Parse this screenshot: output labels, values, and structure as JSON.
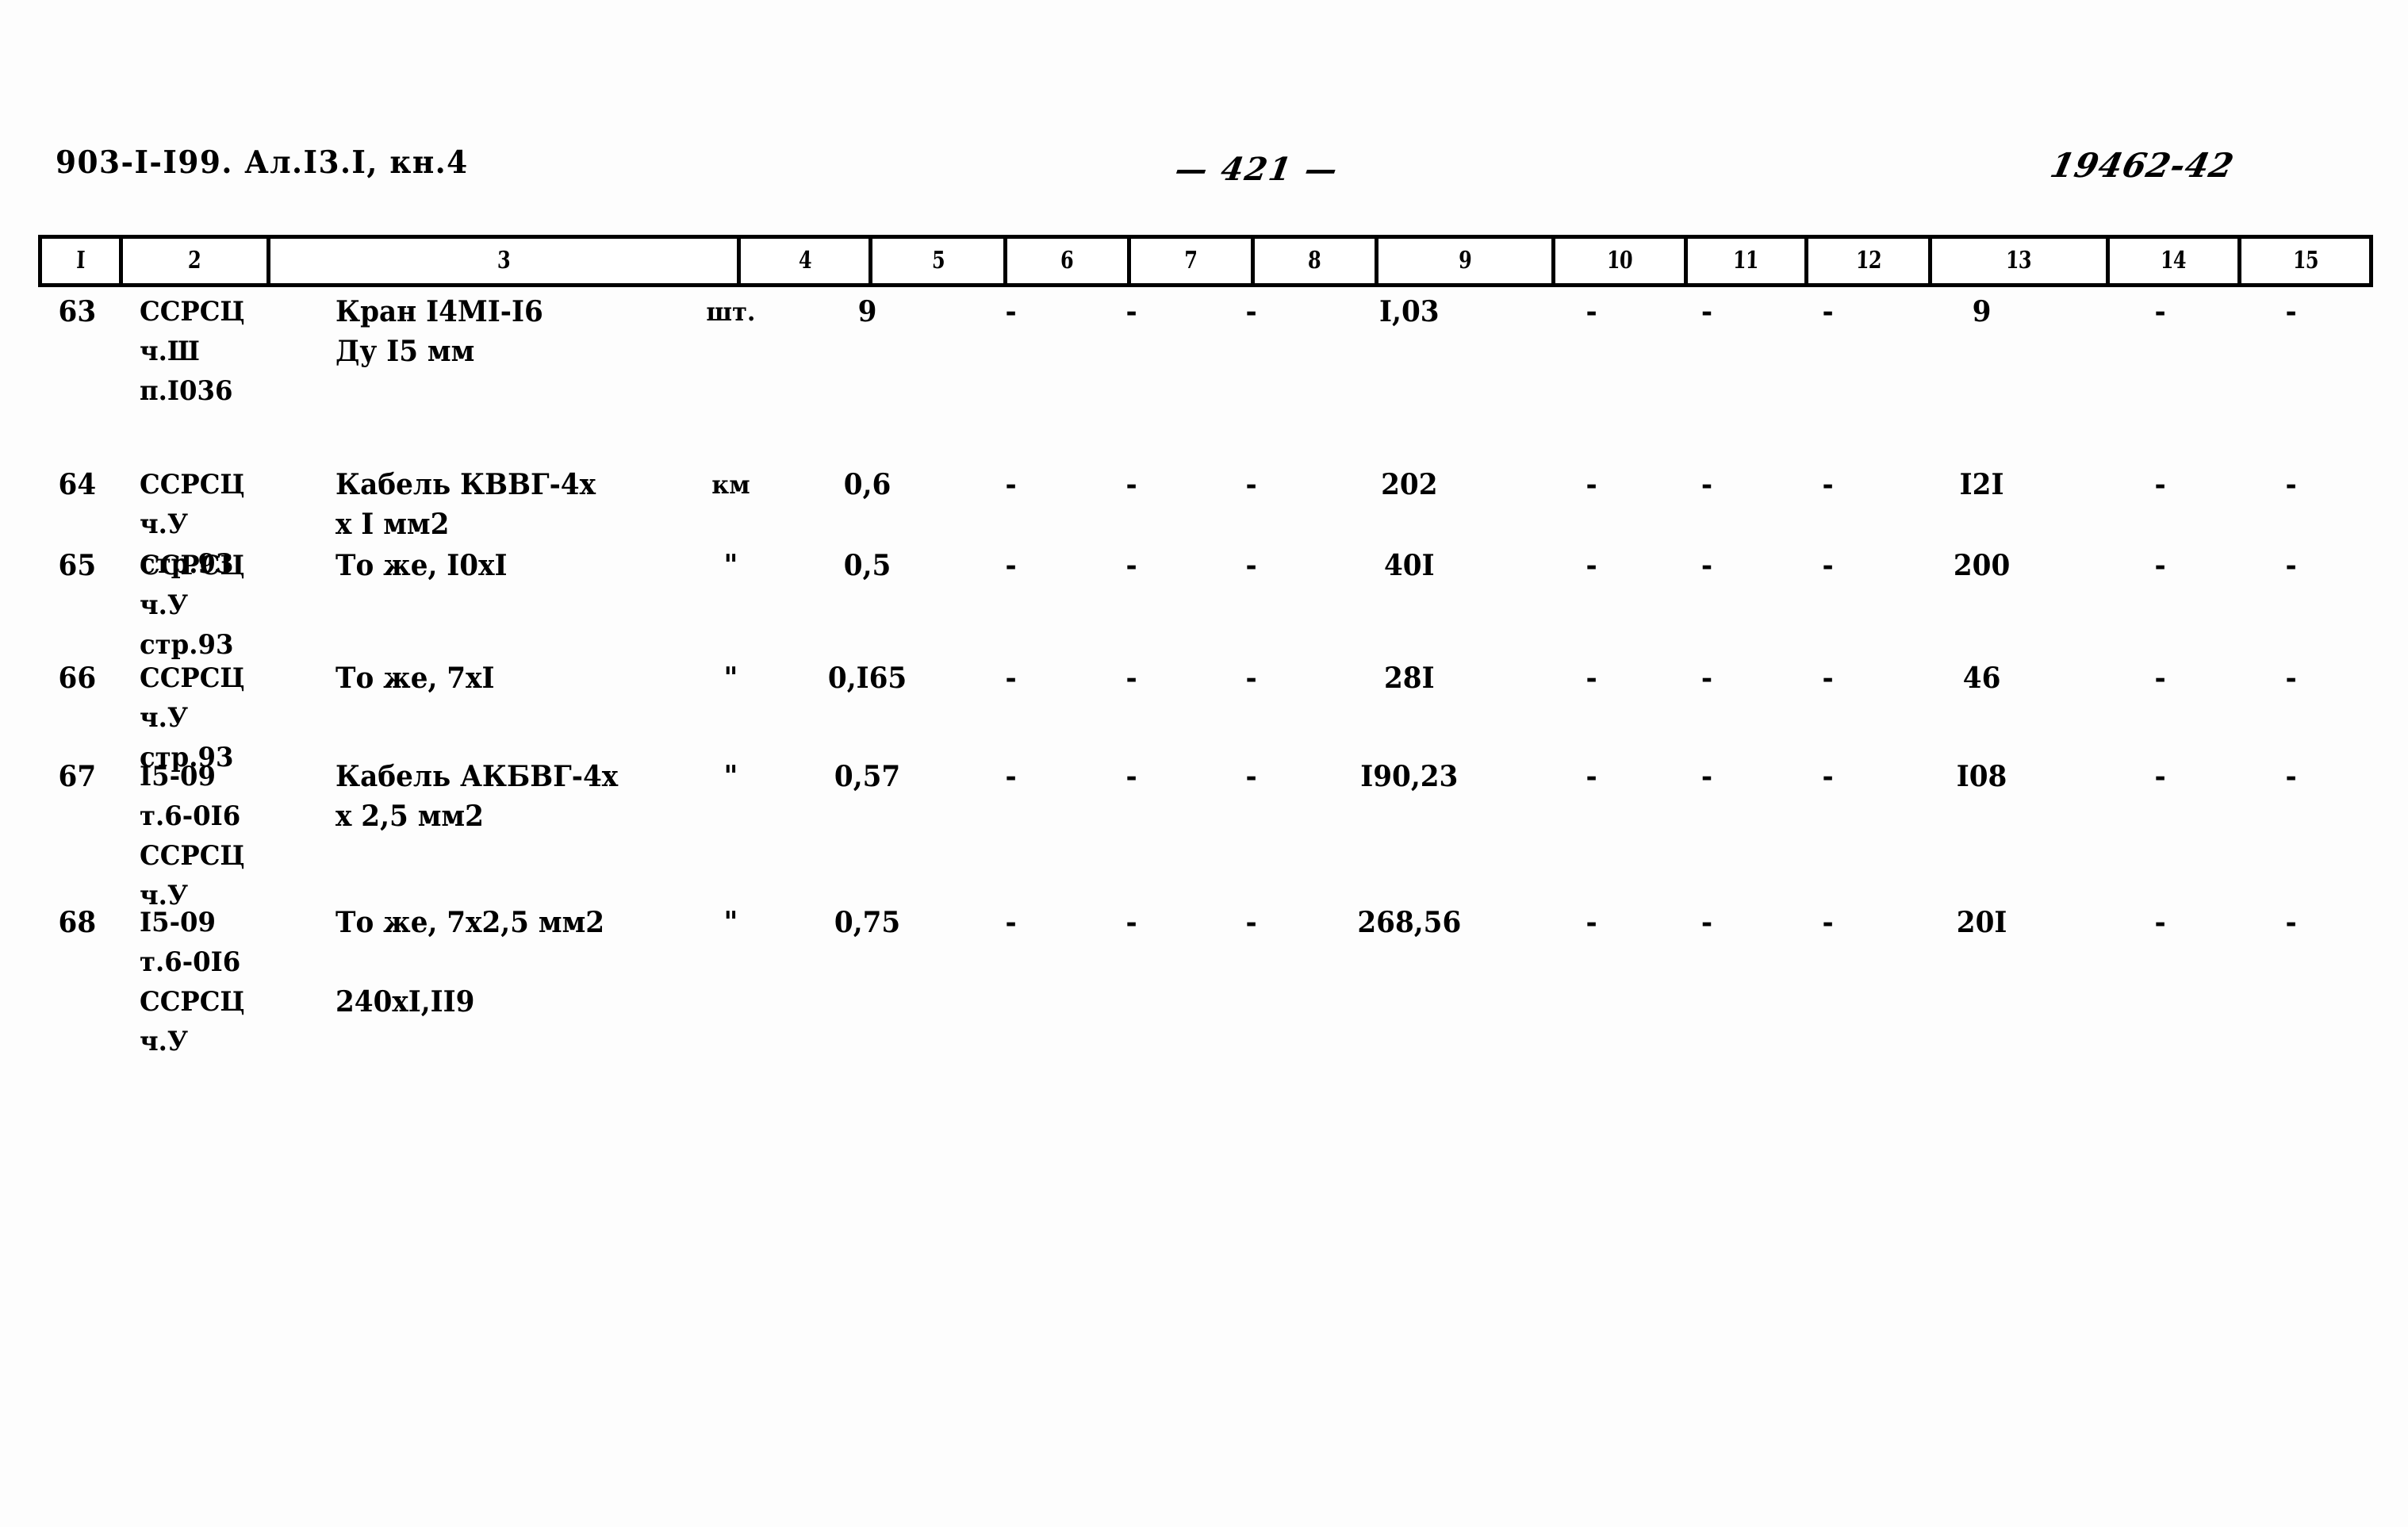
{
  "header": {
    "doc_code": "903-I-I99. Ал.I3.I, кн.4",
    "page_number": "— 421 —",
    "archive_code": "19462-42"
  },
  "table": {
    "column_numbers": [
      "I",
      "2",
      "3",
      "4",
      "5",
      "6",
      "7",
      "8",
      "9",
      "10",
      "11",
      "12",
      "13",
      "14",
      "15"
    ],
    "rows": [
      {
        "num": "63",
        "code_lines": [
          "ССРСЦ",
          "ч.Ш",
          "п.I036"
        ],
        "name_lines": [
          "Кран I4MI-I6",
          "Ду I5 мм"
        ],
        "unit": "шт.",
        "c5": "9",
        "c6": "-",
        "c7": "-",
        "c8": "-",
        "c9": "I,03",
        "c10": "-",
        "c11": "-",
        "c12": "-",
        "c13": "9",
        "c14": "-",
        "c15": "-"
      },
      {
        "num": "64",
        "code_lines": [
          "ССРСЦ",
          "ч.У",
          "стр.93"
        ],
        "name_lines": [
          "Кабель КВВГ-4х",
          "х I мм2"
        ],
        "unit": "км",
        "c5": "0,6",
        "c6": "-",
        "c7": "-",
        "c8": "-",
        "c9": "202",
        "c10": "-",
        "c11": "-",
        "c12": "-",
        "c13": "I2I",
        "c14": "-",
        "c15": "-"
      },
      {
        "num": "65",
        "code_lines": [
          "ССРСЦ",
          "ч.У",
          "стр.93"
        ],
        "name_lines": [
          "То же, I0xI"
        ],
        "unit": "\"",
        "c5": "0,5",
        "c6": "-",
        "c7": "-",
        "c8": "-",
        "c9": "40I",
        "c10": "-",
        "c11": "-",
        "c12": "-",
        "c13": "200",
        "c14": "-",
        "c15": "-"
      },
      {
        "num": "66",
        "code_lines": [
          "ССРСЦ",
          "ч.У",
          "стр.93"
        ],
        "name_lines": [
          "То же, 7хI"
        ],
        "unit": "\"",
        "c5": "0,I65",
        "c6": "-",
        "c7": "-",
        "c8": "-",
        "c9": "28I",
        "c10": "-",
        "c11": "-",
        "c12": "-",
        "c13": "46",
        "c14": "-",
        "c15": "-"
      },
      {
        "num": "67",
        "code_lines": [
          "I5-09",
          "т.6-0I6",
          "ССРСЦ",
          "ч.У"
        ],
        "name_lines": [
          "Кабель АКБВГ-4х",
          "х 2,5 мм2"
        ],
        "unit": "\"",
        "c5": "0,57",
        "c6": "-",
        "c7": "-",
        "c8": "-",
        "c9": "I90,23",
        "c10": "-",
        "c11": "-",
        "c12": "-",
        "c13": "I08",
        "c14": "-",
        "c15": "-"
      },
      {
        "num": "68",
        "code_lines": [
          "I5-09",
          "т.6-0I6",
          "ССРСЦ",
          "ч.У"
        ],
        "name_lines": [
          "То же, 7х2,5 мм2",
          "",
          "240хI,II9"
        ],
        "unit": "\"",
        "c5": "0,75",
        "c6": "-",
        "c7": "-",
        "c8": "-",
        "c9": "268,56",
        "c10": "-",
        "c11": "-",
        "c12": "-",
        "c13": "20I",
        "c14": "-",
        "c15": "-"
      }
    ]
  }
}
